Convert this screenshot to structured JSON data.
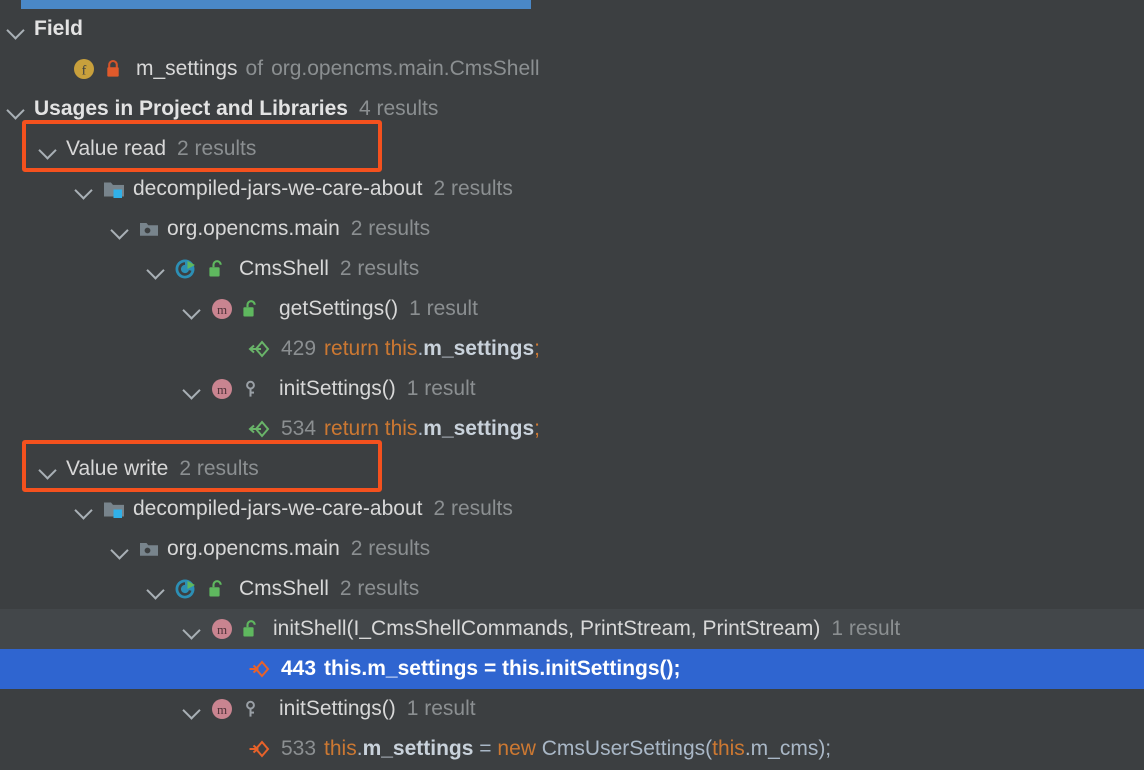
{
  "window": {
    "background_color": "#3c3f41",
    "selection_color": "#2f65d0",
    "accent_color": "#4a88c7",
    "annotation_color": "#f4511e"
  },
  "scrollbar": {
    "name": "horizontal-scrollbar",
    "thumb_color": "#4a88c7"
  },
  "tree": {
    "field_group": {
      "label": "Field",
      "item": {
        "icon": "field-icon",
        "visibility_icon": "private-lock-icon",
        "name": "m_settings",
        "of": "of",
        "owner": "org.opencms.main.CmsShell"
      }
    },
    "usages_root": {
      "label": "Usages in Project and Libraries",
      "count": "4 results"
    },
    "groups": [
      {
        "label": "Value read",
        "count": "2 results",
        "annotated": true,
        "module": {
          "icon": "module-folder-icon",
          "label": "decompiled-jars-we-care-about",
          "count": "2 results"
        },
        "package": {
          "icon": "package-folder-icon",
          "label": "org.opencms.main",
          "count": "2 results"
        },
        "class": {
          "icon": "runnable-class-icon",
          "visibility_icon": "public-unlock-icon",
          "label": "CmsShell",
          "count": "2 results"
        },
        "methods": [
          {
            "icon": "method-icon",
            "visibility_icon": "public-unlock-icon",
            "label": "getSettings()",
            "count": "1 result",
            "usages": [
              {
                "icon": "value-read-arrow-icon",
                "line": "429",
                "tokens": [
                  {
                    "text": "return ",
                    "kind": "kw"
                  },
                  {
                    "text": "this",
                    "kind": "kw"
                  },
                  {
                    "text": ".",
                    "kind": "punct"
                  },
                  {
                    "text": "m_settings",
                    "kind": "fieldref"
                  },
                  {
                    "text": ";",
                    "kind": "kw"
                  }
                ],
                "selected": false
              }
            ]
          },
          {
            "icon": "method-icon",
            "visibility_icon": "private-key-icon",
            "label": "initSettings()",
            "count": "1 result",
            "usages": [
              {
                "icon": "value-read-arrow-icon",
                "line": "534",
                "tokens": [
                  {
                    "text": "return ",
                    "kind": "kw"
                  },
                  {
                    "text": "this",
                    "kind": "kw"
                  },
                  {
                    "text": ".",
                    "kind": "punct"
                  },
                  {
                    "text": "m_settings",
                    "kind": "fieldref"
                  },
                  {
                    "text": ";",
                    "kind": "kw"
                  }
                ],
                "selected": false
              }
            ]
          }
        ]
      },
      {
        "label": "Value write",
        "count": "2 results",
        "annotated": true,
        "module": {
          "icon": "module-folder-icon",
          "label": "decompiled-jars-we-care-about",
          "count": "2 results"
        },
        "package": {
          "icon": "package-folder-icon",
          "label": "org.opencms.main",
          "count": "2 results"
        },
        "class": {
          "icon": "runnable-class-icon",
          "visibility_icon": "public-unlock-icon",
          "label": "CmsShell",
          "count": "2 results"
        },
        "methods": [
          {
            "icon": "method-icon",
            "visibility_icon": "public-unlock-icon",
            "label": "initShell(I_CmsShellCommands, PrintStream, PrintStream)",
            "count": "1 result",
            "hovered": true,
            "usages": [
              {
                "icon": "value-write-arrow-icon",
                "line": "443",
                "tokens": [
                  {
                    "text": "this",
                    "kind": "kw"
                  },
                  {
                    "text": ".",
                    "kind": "punct"
                  },
                  {
                    "text": "m_settings",
                    "kind": "fieldref"
                  },
                  {
                    "text": " = ",
                    "kind": "punct"
                  },
                  {
                    "text": "this",
                    "kind": "plain"
                  },
                  {
                    "text": ".initSettings();",
                    "kind": "plain"
                  }
                ],
                "selected": true
              }
            ]
          },
          {
            "icon": "method-icon",
            "visibility_icon": "private-key-icon",
            "label": "initSettings()",
            "count": "1 result",
            "usages": [
              {
                "icon": "value-write-arrow-icon",
                "line": "533",
                "tokens": [
                  {
                    "text": "this",
                    "kind": "kw"
                  },
                  {
                    "text": ".",
                    "kind": "punct"
                  },
                  {
                    "text": "m_settings",
                    "kind": "fieldref"
                  },
                  {
                    "text": " = ",
                    "kind": "punct"
                  },
                  {
                    "text": "new ",
                    "kind": "kw"
                  },
                  {
                    "text": "CmsUserSettings(",
                    "kind": "plain"
                  },
                  {
                    "text": "this",
                    "kind": "kw"
                  },
                  {
                    "text": ".m_cms);",
                    "kind": "plain"
                  }
                ],
                "selected": false
              }
            ]
          }
        ]
      }
    ]
  }
}
